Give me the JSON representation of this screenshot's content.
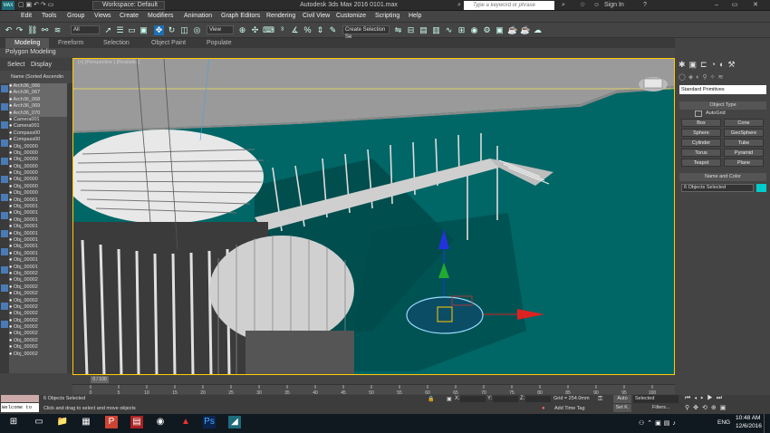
{
  "app": {
    "title": "Autodesk 3ds Max 2016    0101.max",
    "workspace": "Workspace: Default",
    "search_placeholder": "Type a keyword or phrase",
    "sign_in": "Sign In"
  },
  "menu": [
    "Edit",
    "Tools",
    "Group",
    "Views",
    "Create",
    "Modifiers",
    "Animation",
    "Graph Editors",
    "Rendering",
    "Civil View",
    "Customize",
    "Scripting",
    "Help"
  ],
  "toolbar": {
    "filter_select": "All",
    "view_select": "View",
    "selection_set": "Create Selection Se"
  },
  "ribbon": {
    "tabs": [
      "Modeling",
      "Freeform",
      "Selection",
      "Object Paint",
      "Populate"
    ],
    "active_tab": "Modeling",
    "sub_label": "Polygon Modeling"
  },
  "scene_explorer": {
    "tabs": [
      "Select",
      "Display"
    ],
    "header": "Name (Sorted Ascendin",
    "items": [
      "Arch36_066",
      "Arch36_067",
      "Arch36_068",
      "Arch36_069",
      "Arch36_070",
      "Camera001",
      "Camera001",
      "Compass00",
      "Compass00",
      "Obj_00000",
      "Obj_00000",
      "Obj_00000",
      "Obj_00000",
      "Obj_00000",
      "Obj_00000",
      "Obj_00000",
      "Obj_00000",
      "Obj_00001",
      "Obj_00001",
      "Obj_00001",
      "Obj_00001",
      "Obj_00001",
      "Obj_00001",
      "Obj_00001",
      "Obj_00001",
      "Obj_00001",
      "Obj_00001",
      "Obj_00001",
      "Obj_00002",
      "Obj_00002",
      "Obj_00002",
      "Obj_00002",
      "Obj_00002",
      "Obj_00002",
      "Obj_00002",
      "Obj_00002",
      "Obj_00002",
      "Obj_00002",
      "Obj_00002",
      "Obj_00002",
      "Obj_00002"
    ]
  },
  "viewport": {
    "label": "[+] [Perspective ] [Realistic ]"
  },
  "command_panel": {
    "dropdown": "Standard Primitives",
    "object_type_header": "Object Type",
    "autogrid": "AutoGrid",
    "buttons": [
      "Box",
      "Cone",
      "Sphere",
      "GeoSphere",
      "Cylinder",
      "Tube",
      "Torus",
      "Pyramid",
      "Teapot",
      "Plane"
    ],
    "name_color_header": "Name and Color",
    "name_value": "6 Objects Selected"
  },
  "timeline": {
    "frame": "0 / 100",
    "ticks": [
      "0",
      "5",
      "10",
      "15",
      "20",
      "25",
      "30",
      "35",
      "40",
      "45",
      "50",
      "55",
      "60",
      "65",
      "70",
      "75",
      "80",
      "85",
      "90",
      "95",
      "100"
    ]
  },
  "status": {
    "welcome": "Welcome to",
    "selected": "6 Objects Selected",
    "prompt": "Click and drag to select and move objects",
    "x_label": "X:",
    "y_label": "Y:",
    "z_label": "Z:",
    "grid": "Grid = 254.0mm",
    "add_time_tag": "Add Time Tag",
    "auto": "Auto",
    "set_key": "Set K.",
    "selected_dropdown": "Selected",
    "filters": "Filters..."
  },
  "taskbar": {
    "time": "10:48 AM",
    "date": "12/6/2016",
    "lang": "ENG"
  }
}
